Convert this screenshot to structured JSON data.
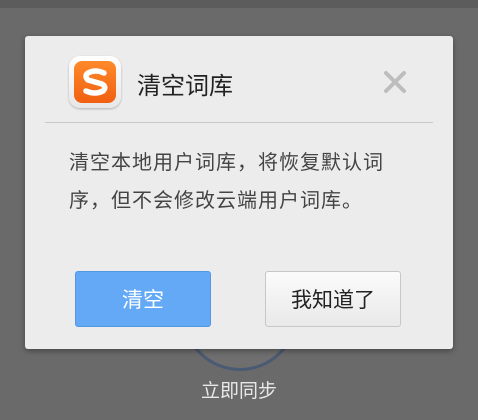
{
  "dialog": {
    "title": "清空词库",
    "message": "清空本地用户词库，将恢复默认词序，但不会修改云端用户词库。",
    "confirm_label": "清空",
    "dismiss_label": "我知道了",
    "close_icon": "close-icon",
    "app_icon": "sogou-s-icon"
  },
  "background": {
    "sync_label": "立即同步"
  },
  "colors": {
    "primary_button": "#63a9f5",
    "app_icon_orange": "#f06010",
    "dialog_bg": "#ececec",
    "overlay": "#6a6a6a"
  }
}
